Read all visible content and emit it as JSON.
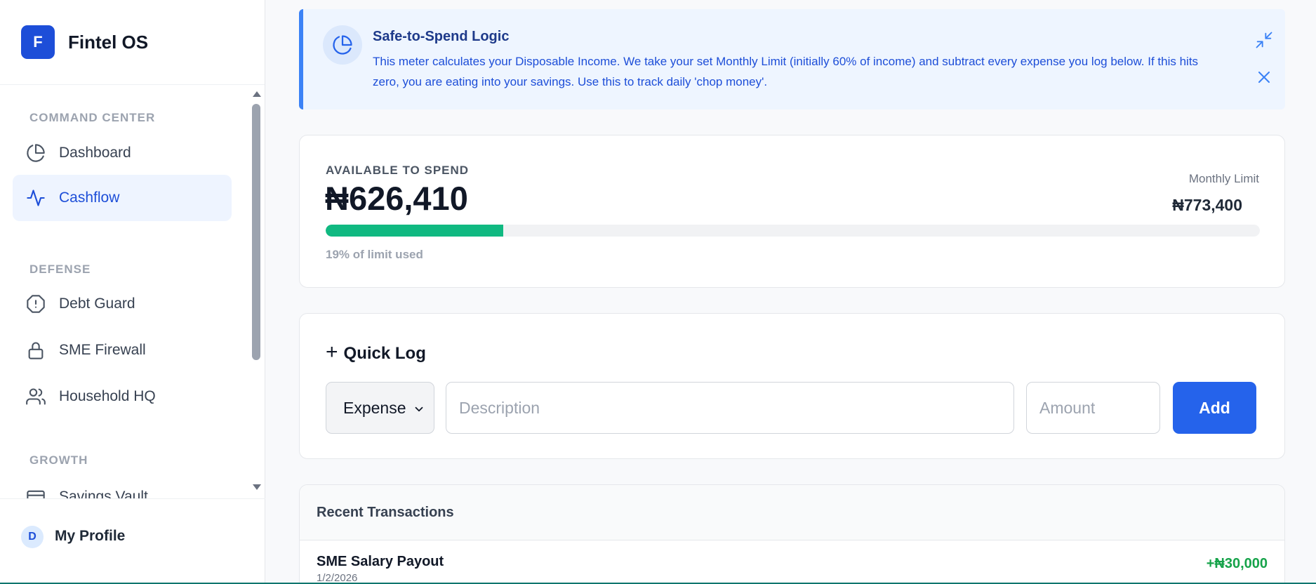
{
  "brand": {
    "logo_letter": "F",
    "name": "Fintel OS"
  },
  "sidebar": {
    "sections": [
      {
        "title": "COMMAND CENTER"
      },
      {
        "title": "DEFENSE"
      },
      {
        "title": "GROWTH"
      }
    ],
    "items": [
      {
        "label": "Dashboard",
        "icon": "pie-chart-icon"
      },
      {
        "label": "Cashflow",
        "icon": "activity-icon",
        "active": true
      },
      {
        "label": "Debt Guard",
        "icon": "alert-octagon-icon"
      },
      {
        "label": "SME Firewall",
        "icon": "lock-icon"
      },
      {
        "label": "Household HQ",
        "icon": "users-icon"
      },
      {
        "label": "Savings Vault",
        "icon": "wallet-icon"
      }
    ]
  },
  "profile": {
    "initial": "D",
    "label": "My Profile"
  },
  "banner": {
    "title": "Safe-to-Spend Logic",
    "text": "This meter calculates your Disposable Income. We take your set Monthly Limit (initially 60% of income) and subtract every expense you log below. If this hits zero, you are eating into your savings. Use this to track daily 'chop money'."
  },
  "spend": {
    "label": "AVAILABLE TO SPEND",
    "amount": "₦626,410",
    "limit_label": "Monthly Limit",
    "limit_amount": "₦773,400",
    "used_fraction": 0.19,
    "used_note": "19% of limit used"
  },
  "quick_log": {
    "title": "Quick Log",
    "type_value": "Expense",
    "description_placeholder": "Description",
    "amount_placeholder": "Amount",
    "add_label": "Add"
  },
  "transactions": {
    "title": "Recent Transactions",
    "rows": [
      {
        "name": "SME Salary Payout",
        "date": "1/2/2026",
        "amount": "+₦30,000"
      }
    ]
  },
  "colors": {
    "accent": "#2563eb",
    "progress": "#10b981",
    "income": "#16a34a"
  }
}
